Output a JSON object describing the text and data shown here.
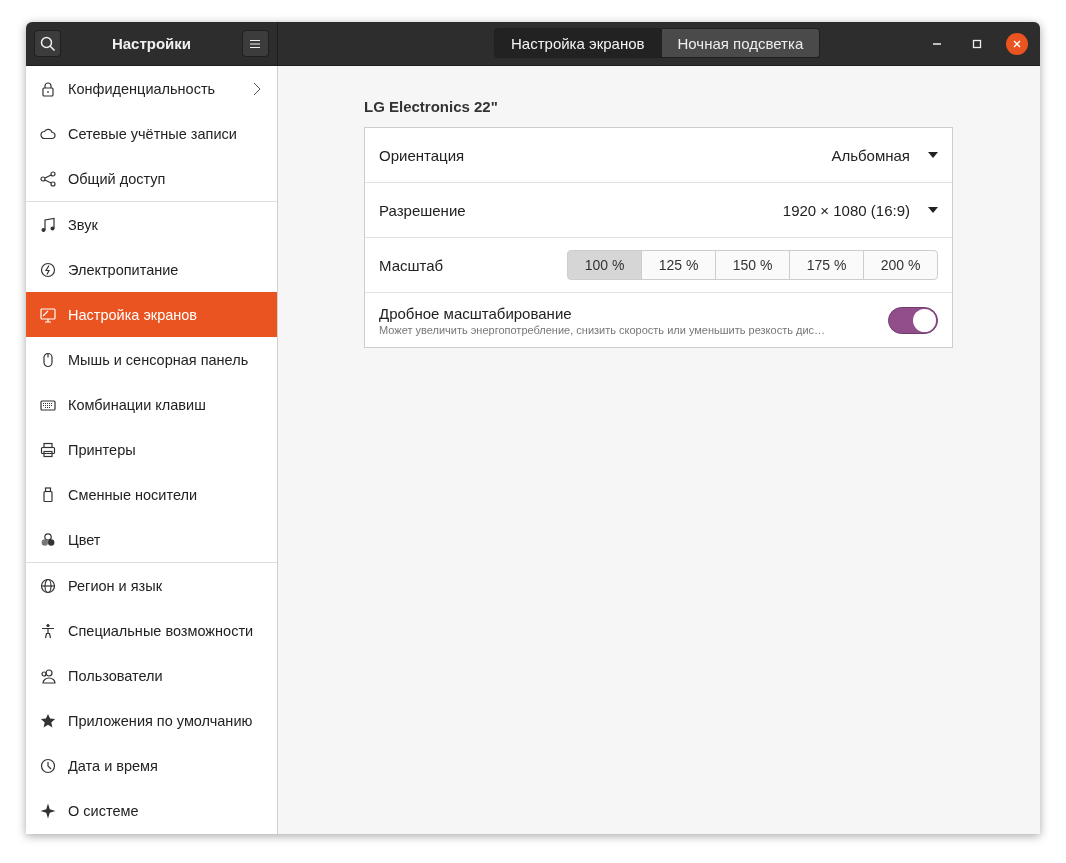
{
  "window": {
    "title": "Настройки"
  },
  "tabs": [
    {
      "label": "Настройка экранов",
      "selected": true
    },
    {
      "label": "Ночная подсветка",
      "selected": false
    }
  ],
  "sidebar": {
    "groups": [
      {
        "items": [
          {
            "label": "Конфиденциальность",
            "selected": false,
            "has_submenu": true
          },
          {
            "label": "Сетевые учётные записи",
            "selected": false,
            "has_submenu": false
          },
          {
            "label": "Общий доступ",
            "selected": false,
            "has_submenu": false
          }
        ]
      },
      {
        "items": [
          {
            "label": "Звук",
            "selected": false,
            "has_submenu": false
          },
          {
            "label": "Электропитание",
            "selected": false,
            "has_submenu": false
          },
          {
            "label": "Настройка экранов",
            "selected": true,
            "has_submenu": false
          },
          {
            "label": "Мышь и сенсорная панель",
            "selected": false,
            "has_submenu": false
          },
          {
            "label": "Комбинации клавиш",
            "selected": false,
            "has_submenu": false
          },
          {
            "label": "Принтеры",
            "selected": false,
            "has_submenu": false
          },
          {
            "label": "Сменные носители",
            "selected": false,
            "has_submenu": false
          },
          {
            "label": "Цвет",
            "selected": false,
            "has_submenu": false
          }
        ]
      },
      {
        "items": [
          {
            "label": "Регион и язык",
            "selected": false,
            "has_submenu": false
          },
          {
            "label": "Специальные возможности",
            "selected": false,
            "has_submenu": false
          },
          {
            "label": "Пользователи",
            "selected": false,
            "has_submenu": false
          },
          {
            "label": "Приложения по умолчанию",
            "selected": false,
            "has_submenu": false
          },
          {
            "label": "Дата и время",
            "selected": false,
            "has_submenu": false
          },
          {
            "label": "О системе",
            "selected": false,
            "has_submenu": false
          }
        ]
      }
    ]
  },
  "display": {
    "title": "LG Electronics 22\"",
    "rows": [
      {
        "kind": "dropdown",
        "label": "Ориентация",
        "value": "Альбомная"
      },
      {
        "kind": "dropdown",
        "label": "Разрешение",
        "value": "1920 × 1080 (16:9)"
      },
      {
        "kind": "segmented",
        "label": "Масштаб",
        "options": [
          {
            "label": "100 %",
            "selected": true
          },
          {
            "label": "125 %",
            "selected": false
          },
          {
            "label": "150 %",
            "selected": false
          },
          {
            "label": "175 %",
            "selected": false
          },
          {
            "label": "200 %",
            "selected": false
          }
        ]
      },
      {
        "kind": "switch",
        "label": "Дробное масштабирование",
        "description": "Может увеличить энергопотребление, снизить скорость или уменьшить резкость дис…",
        "on": true
      }
    ]
  }
}
